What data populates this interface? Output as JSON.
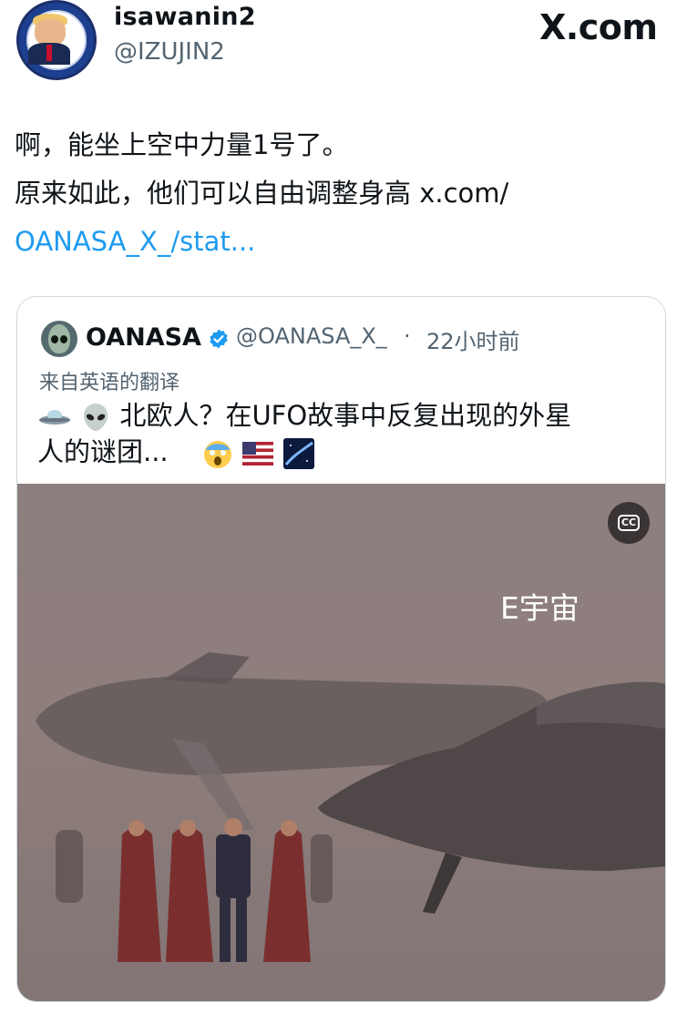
{
  "author": {
    "display_name": "isawanin2",
    "handle": "@IZUJIN2",
    "avatar_icon": "avatar-portrait-badge"
  },
  "brand": {
    "logo_text": "X.com"
  },
  "tweet": {
    "line1": "啊，能坐上空中力量1号了。",
    "line2": "原来如此，他们可以自由调整身高 x.com/",
    "link_text": "OANASA_X_/stat..."
  },
  "quoted": {
    "display_name": "OANASA",
    "handle": "@OANASA_X_",
    "separator": "·",
    "time": "22小时前",
    "translated_label": "来自英语的翻译",
    "text_line1": "北欧人？在UFO故事中反复出现的外星",
    "text_line2": "人的谜团...",
    "leading_emojis": [
      "flying-saucer-emoji",
      "alien-emoji"
    ],
    "trailing_emojis": [
      "scream-emoji",
      "us-flag-emoji",
      "galaxy-emoji"
    ],
    "media": {
      "watermark": "E宇宙",
      "caption_button_icon": "closed-captions-icon"
    }
  },
  "colors": {
    "link": "#1d9bf0",
    "secondary_text": "#536471",
    "border": "#cfd9de",
    "verified": "#1d9bf0"
  }
}
